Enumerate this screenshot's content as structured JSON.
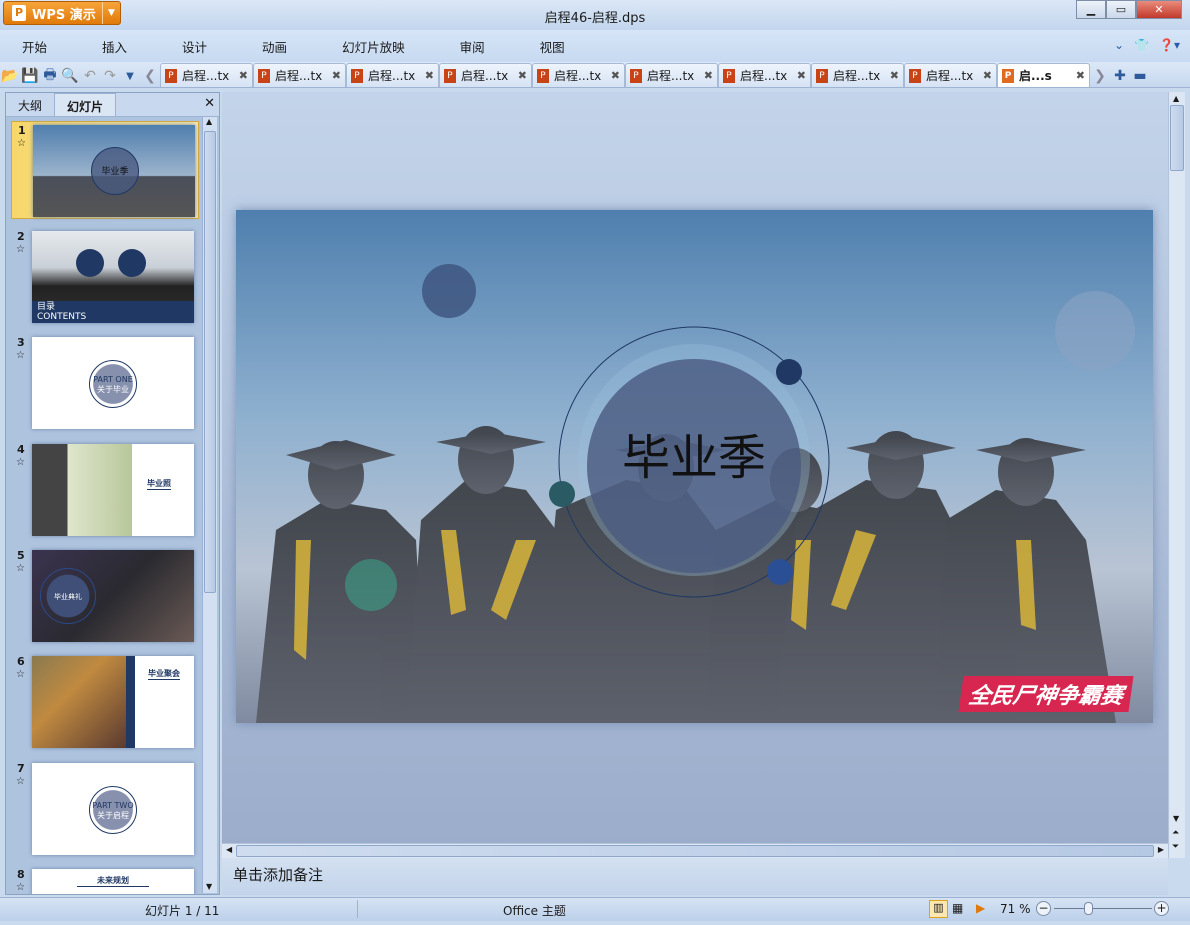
{
  "app": {
    "name": "WPS 演示",
    "window_title": "启程46-启程.dps"
  },
  "menu": [
    "开始",
    "插入",
    "设计",
    "动画",
    "幻灯片放映",
    "审阅",
    "视图"
  ],
  "doc_tabs": [
    "启程...tx",
    "启程...tx",
    "启程...tx",
    "启程...tx",
    "启程...tx",
    "启程...tx",
    "启程...tx",
    "启程...tx",
    "启程...tx",
    "启...s"
  ],
  "panel": {
    "tabs": [
      "大纲",
      "幻灯片"
    ],
    "active_tab": "幻灯片"
  },
  "slides": [
    {
      "num": "1",
      "text": "毕业季"
    },
    {
      "num": "2",
      "text": "目录",
      "sub": "CONTENTS"
    },
    {
      "num": "3",
      "text": "PART ONE",
      "sub": "关于毕业"
    },
    {
      "num": "4",
      "text": "毕业照"
    },
    {
      "num": "5",
      "text": "毕业典礼"
    },
    {
      "num": "6",
      "text": "毕业聚会"
    },
    {
      "num": "7",
      "text": "PART TWO",
      "sub": "关于启程"
    },
    {
      "num": "8",
      "text": "未来规划"
    }
  ],
  "main_slide": {
    "title": "毕业季",
    "logo": "全民尸神争霸赛"
  },
  "notes_placeholder": "单击添加备注",
  "status": {
    "slide_counter": "幻灯片 1 / 11",
    "theme": "Office 主题",
    "zoom": "71 %",
    "zoom_percent": 71
  },
  "colors": {
    "accent": "#e07a0a",
    "navy": "#1f3864"
  }
}
